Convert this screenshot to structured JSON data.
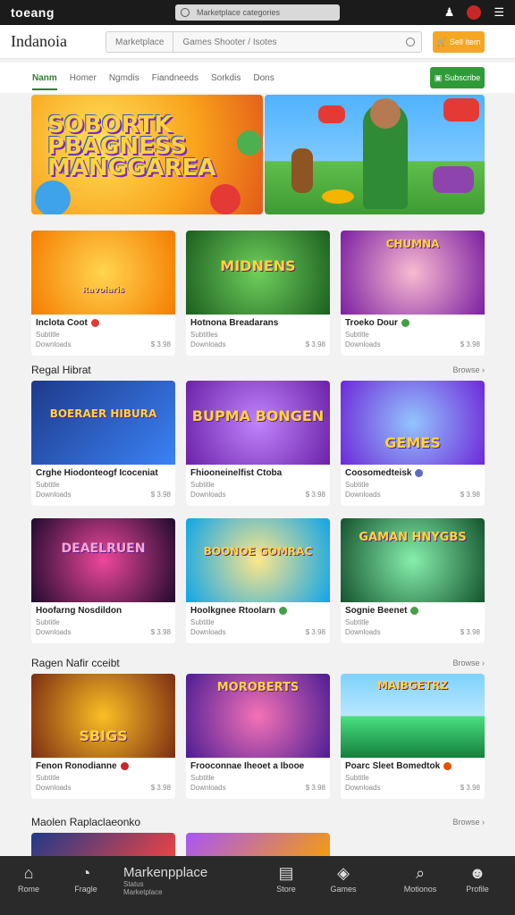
{
  "topbar": {
    "logo": "toeang",
    "search_text": "Marketplace categories"
  },
  "header": {
    "brand": "Indanoia",
    "search_category": "Marketplace",
    "search_text": "Games Shooter / Isotes",
    "primary_button": "Sell item"
  },
  "nav": {
    "items": [
      "Nanm",
      "Homer",
      "Ngmdis",
      "Fiandneeds",
      "Sorkdis",
      "Dons"
    ],
    "button": "Subscribe"
  },
  "banner": {
    "title": "SOBORTK PBAGNESS MANGGAREA"
  },
  "sections": [
    {
      "title": "",
      "more": "",
      "cards": [
        {
          "title": "Inclota Coot",
          "sub": "Subtitle",
          "meta": "Downloads",
          "price": "$ 3.98",
          "accent": "#e53935",
          "thumb_text": "Ravoiaris"
        },
        {
          "title": "Hotnona Breadarans",
          "sub": "Subtitles",
          "meta": "Downloads",
          "price": "$ 3.98",
          "accent": "#2e7d32",
          "thumb_text": "MIDNENS"
        },
        {
          "title": "Troeko Dour",
          "sub": "Subtitle",
          "meta": "Downloads",
          "price": "$ 3.98",
          "accent": "#43a047",
          "thumb_text": "CHUMNA"
        }
      ]
    },
    {
      "title": "Regal Hibrat",
      "more": "Browse",
      "cards": [
        {
          "title": "Crghe Hiodonteogf Icoceniat",
          "sub": "Subtitle",
          "meta": "Downloads",
          "price": "$ 3.98",
          "accent": "",
          "thumb_text": "BOERAER HIBURA"
        },
        {
          "title": "Fhiooneinelfist Ctoba",
          "sub": "Subtitle",
          "meta": "Downloads",
          "price": "$ 3.98",
          "accent": "",
          "thumb_text": "BUPMA BONGEN"
        },
        {
          "title": "Coosomedteisk",
          "sub": "Subtitle",
          "meta": "Downloads",
          "price": "$ 3.98",
          "accent": "#5c6bc0",
          "thumb_text": "GEMES"
        }
      ]
    },
    {
      "title": "",
      "more": "",
      "cards": [
        {
          "title": "Hoofarng Nosdildon",
          "sub": "Subtitle",
          "meta": "Downloads",
          "price": "$ 3.98",
          "accent": "",
          "thumb_text": "DEAELRUEN"
        },
        {
          "title": "Hoolkgnee Rtoolarn",
          "sub": "Subtitle",
          "meta": "Downloads",
          "price": "$ 3.98",
          "accent": "#43a047",
          "thumb_text": "BOONOE GOMRAC"
        },
        {
          "title": "Sognie Beenet",
          "sub": "Subtitle",
          "meta": "Downloads",
          "price": "$ 3.98",
          "accent": "#43a047",
          "thumb_text": "GAMAN HNYGBS"
        }
      ]
    },
    {
      "title": "Ragen Nafir cceibt",
      "more": "Browse",
      "cards": [
        {
          "title": "Fenon Ronodianne",
          "sub": "Subtitle",
          "meta": "Downloads",
          "price": "$ 3.98",
          "accent": "#c62828",
          "thumb_text": "SBIGS"
        },
        {
          "title": "Frooconnae Iheoet a Ibooe",
          "sub": "Subtitle",
          "meta": "Downloads",
          "price": "$ 3.98",
          "accent": "",
          "thumb_text": "MOROBERTS"
        },
        {
          "title": "Poarc Sleet Bomedtok",
          "sub": "Subtitle",
          "meta": "Downloads",
          "price": "$ 3.98",
          "accent": "#e65100",
          "thumb_text": "MAIBGETRZ"
        }
      ]
    },
    {
      "title": "Maolen Raplaclaeonko",
      "more": "Browse",
      "cards": []
    }
  ],
  "bottom_nav": {
    "left": [
      {
        "label": "Rome",
        "icon": "home-icon"
      },
      {
        "label": "Fragle",
        "icon": "bell-icon"
      }
    ],
    "center": {
      "title": "Markenpplace",
      "sub1": "Status",
      "sub2": "Marketplace"
    },
    "right": [
      {
        "label": "Store",
        "icon": "store-icon"
      },
      {
        "label": "Games",
        "icon": "games-icon"
      },
      {
        "label": "Motionos",
        "icon": "search-icon"
      },
      {
        "label": "Profile",
        "icon": "profile-icon"
      }
    ]
  },
  "colors": {
    "accent_green": "#2e9b38",
    "accent_orange": "#f5a623",
    "topbar": "#1b1b1b",
    "bottom_bar": "#2a2a2a"
  }
}
